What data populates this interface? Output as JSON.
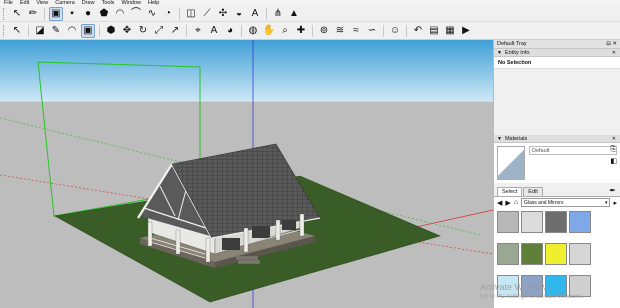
{
  "menu": [
    "File",
    "Edit",
    "View",
    "Camera",
    "Draw",
    "Tools",
    "Window",
    "Help"
  ],
  "toolbar_top": [
    {
      "name": "select-tool-icon",
      "glyph": "↖"
    },
    {
      "name": "line-tool-icon",
      "glyph": "✏"
    },
    {
      "name": "rectangle-tool-icon",
      "glyph": "▣",
      "selected": true
    },
    {
      "name": "square-tool-icon",
      "glyph": "▪"
    },
    {
      "name": "circle-tool-icon",
      "glyph": "●"
    },
    {
      "name": "polygon-tool-icon",
      "glyph": "⬟"
    },
    {
      "name": "arc-tool-icon",
      "glyph": "◠"
    },
    {
      "name": "arc-2pt-tool-icon",
      "glyph": "⌒"
    },
    {
      "name": "freehand-tool-icon",
      "glyph": "∿"
    },
    {
      "name": "pie-tool-icon",
      "glyph": "◔"
    },
    {
      "name": "offset-tool-icon",
      "glyph": "◫"
    },
    {
      "name": "tape-measure-icon",
      "glyph": "⟋"
    },
    {
      "name": "protractor-icon",
      "glyph": "✣"
    },
    {
      "name": "dimension-icon",
      "glyph": "◒"
    },
    {
      "name": "text-tool-icon",
      "glyph": "A"
    },
    {
      "name": "axes-tool-icon",
      "glyph": "⋔"
    },
    {
      "name": "section-plane-icon",
      "glyph": "▲"
    }
  ],
  "toolbar_bottom": [
    {
      "name": "select-arrow-icon",
      "glyph": "↖"
    },
    {
      "name": "eraser-icon",
      "glyph": "◪"
    },
    {
      "name": "pencil-icon",
      "glyph": "✎"
    },
    {
      "name": "arc-draw-icon",
      "glyph": "◠"
    },
    {
      "name": "rectangle-draw-icon",
      "glyph": "▣",
      "selected": true
    },
    {
      "name": "push-pull-icon",
      "glyph": "⬢"
    },
    {
      "name": "move-icon",
      "glyph": "✥"
    },
    {
      "name": "rotate-icon",
      "glyph": "↻"
    },
    {
      "name": "scale-icon",
      "glyph": "⤢"
    },
    {
      "name": "follow-me-icon",
      "glyph": "↗"
    },
    {
      "name": "tape-icon",
      "glyph": "⌖"
    },
    {
      "name": "text-icon",
      "glyph": "A"
    },
    {
      "name": "paint-bucket-icon",
      "glyph": "◕"
    },
    {
      "name": "orbit-icon",
      "glyph": "◍"
    },
    {
      "name": "pan-icon",
      "glyph": "✋"
    },
    {
      "name": "zoom-icon",
      "glyph": "⌕"
    },
    {
      "name": "zoom-extents-icon",
      "glyph": "✚"
    },
    {
      "name": "warehouse-icon",
      "glyph": "⊚"
    },
    {
      "name": "sandbox-1-icon",
      "glyph": "≋"
    },
    {
      "name": "sandbox-2-icon",
      "glyph": "≈"
    },
    {
      "name": "sandbox-3-icon",
      "glyph": "∽"
    },
    {
      "name": "user-icon",
      "glyph": "☺"
    },
    {
      "name": "undo-icon",
      "glyph": "↶"
    },
    {
      "name": "scenes-icon",
      "glyph": "▤"
    },
    {
      "name": "export-icon",
      "glyph": "▦"
    },
    {
      "name": "play-icon",
      "glyph": "▶"
    }
  ],
  "tray": {
    "title": "Default Tray",
    "entity_info": {
      "title": "Entity Info",
      "value": "No Selection"
    },
    "materials": {
      "title": "Materials",
      "current_name": "Default",
      "tabs": [
        "Select",
        "Edit"
      ],
      "library": "Glass and Mirrors",
      "swatches": [
        {
          "name": "swatch-1",
          "color": "#b8b8b8"
        },
        {
          "name": "swatch-2",
          "color": "#dcdcdc"
        },
        {
          "name": "swatch-3",
          "color": "#6d6d6d"
        },
        {
          "name": "swatch-4",
          "color": "#7fa8e8"
        },
        {
          "name": "swatch-5",
          "color": "#9aa792"
        },
        {
          "name": "swatch-6",
          "color": "#5f7e38"
        },
        {
          "name": "swatch-7",
          "color": "#f0ef2e"
        },
        {
          "name": "swatch-8",
          "color": "#d6d6d6"
        },
        {
          "name": "swatch-9",
          "color": "#c5e6f2"
        },
        {
          "name": "swatch-10",
          "color": "#8ea2c6"
        },
        {
          "name": "swatch-11",
          "color": "#2fb6ea"
        },
        {
          "name": "swatch-12",
          "color": "#cfcfcf"
        }
      ]
    }
  },
  "watermark": {
    "line1": "Activate Windows",
    "line2": "Go to PC settings to activate Windows."
  },
  "colors": {
    "sky": "#c4e2f2",
    "ground": "#c0c0c0",
    "grass": "#3b5e2a",
    "roof": "#545454"
  }
}
